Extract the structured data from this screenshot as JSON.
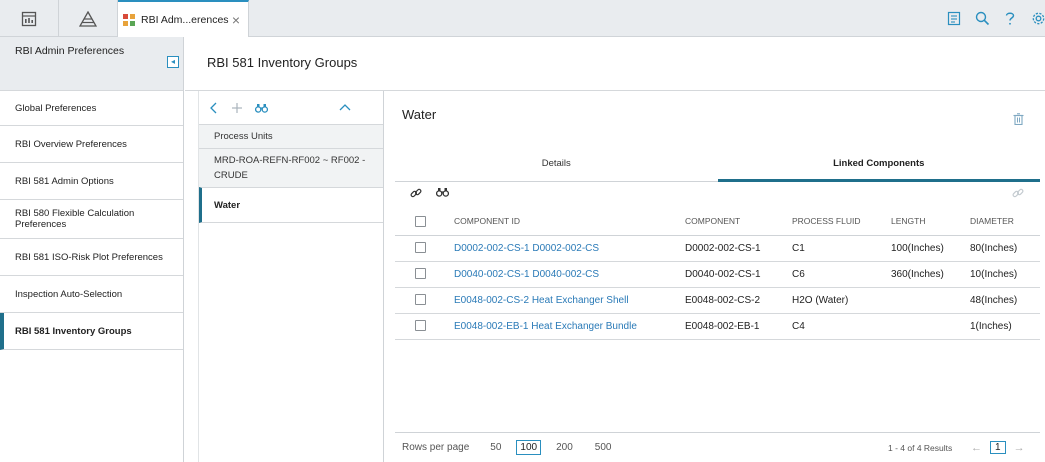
{
  "topbar": {
    "tab_label": "RBI Adm...erences",
    "close": "×"
  },
  "leftnav": {
    "title": "RBI Admin Preferences",
    "items": [
      {
        "label": "Global Preferences"
      },
      {
        "label": "RBI Overview Preferences"
      },
      {
        "label": "RBI 581 Admin Options"
      },
      {
        "label": "RBI 580 Flexible Calculation Preferences"
      },
      {
        "label": "RBI 581 ISO-Risk Plot Preferences"
      },
      {
        "label": "Inspection Auto-Selection"
      },
      {
        "label": "RBI 581 Inventory Groups"
      }
    ]
  },
  "page": {
    "title": "RBI 581 Inventory Groups"
  },
  "midpanel": {
    "rows": [
      {
        "label": "Process Units"
      },
      {
        "label": "MRD-ROA-REFN-RF002 ~ RF002 - CRUDE"
      },
      {
        "label": "Water"
      }
    ]
  },
  "detail": {
    "title": "Water",
    "tabs": [
      {
        "label": "Details"
      },
      {
        "label": "Linked Components"
      }
    ],
    "columns": [
      "COMPONENT ID",
      "COMPONENT",
      "PROCESS FLUID",
      "LENGTH",
      "DIAMETER"
    ],
    "rows": [
      {
        "id": "D0002-002-CS-1 D0002-002-CS",
        "component": "D0002-002-CS-1",
        "fluid": "C1",
        "length": "100(Inches)",
        "diameter": "80(Inches)"
      },
      {
        "id": "D0040-002-CS-1 D0040-002-CS",
        "component": "D0040-002-CS-1",
        "fluid": "C6",
        "length": "360(Inches)",
        "diameter": "10(Inches)"
      },
      {
        "id": "E0048-002-CS-2 Heat Exchanger Shell",
        "component": "E0048-002-CS-2",
        "fluid": "H2O (Water)",
        "length": "",
        "diameter": "48(Inches)"
      },
      {
        "id": "E0048-002-EB-1 Heat Exchanger Bundle",
        "component": "E0048-002-EB-1",
        "fluid": "C4",
        "length": "",
        "diameter": "1(Inches)"
      }
    ]
  },
  "footer": {
    "rows_per_page_label": "Rows per page",
    "options": [
      "50",
      "100",
      "200",
      "500"
    ],
    "summary": "1 - 4 of 4 Results",
    "page": "1",
    "prev": "←",
    "next": "→"
  },
  "colors": {
    "accent": "#1f6f8b",
    "link": "#2a7ab7"
  }
}
